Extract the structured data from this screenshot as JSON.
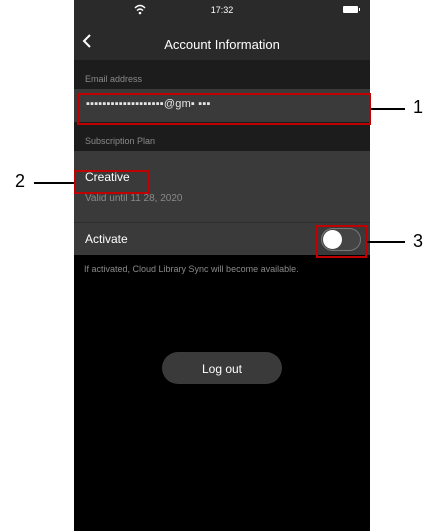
{
  "status_bar": {
    "time": "17:32"
  },
  "nav": {
    "title": "Account Information"
  },
  "email": {
    "section_label": "Email address",
    "value": "▪▪▪▪▪▪▪▪▪▪▪▪▪▪▪▪▪▪▪@gm▪ ▪▪▪"
  },
  "plan": {
    "section_label": "Subscription Plan",
    "name": "Creative",
    "valid_until": "Valid until 11 28, 2020"
  },
  "activate": {
    "label": "Activate",
    "toggle_state": "off",
    "helper": "If activated, Cloud Library Sync will become available."
  },
  "logout": {
    "label": "Log out"
  },
  "callouts": [
    {
      "number": "1"
    },
    {
      "number": "2"
    },
    {
      "number": "3"
    }
  ],
  "colors": {
    "highlight": "#c00000",
    "background": "#000000",
    "row": "#3a3a3a",
    "muted_text": "#8a8a8a"
  }
}
